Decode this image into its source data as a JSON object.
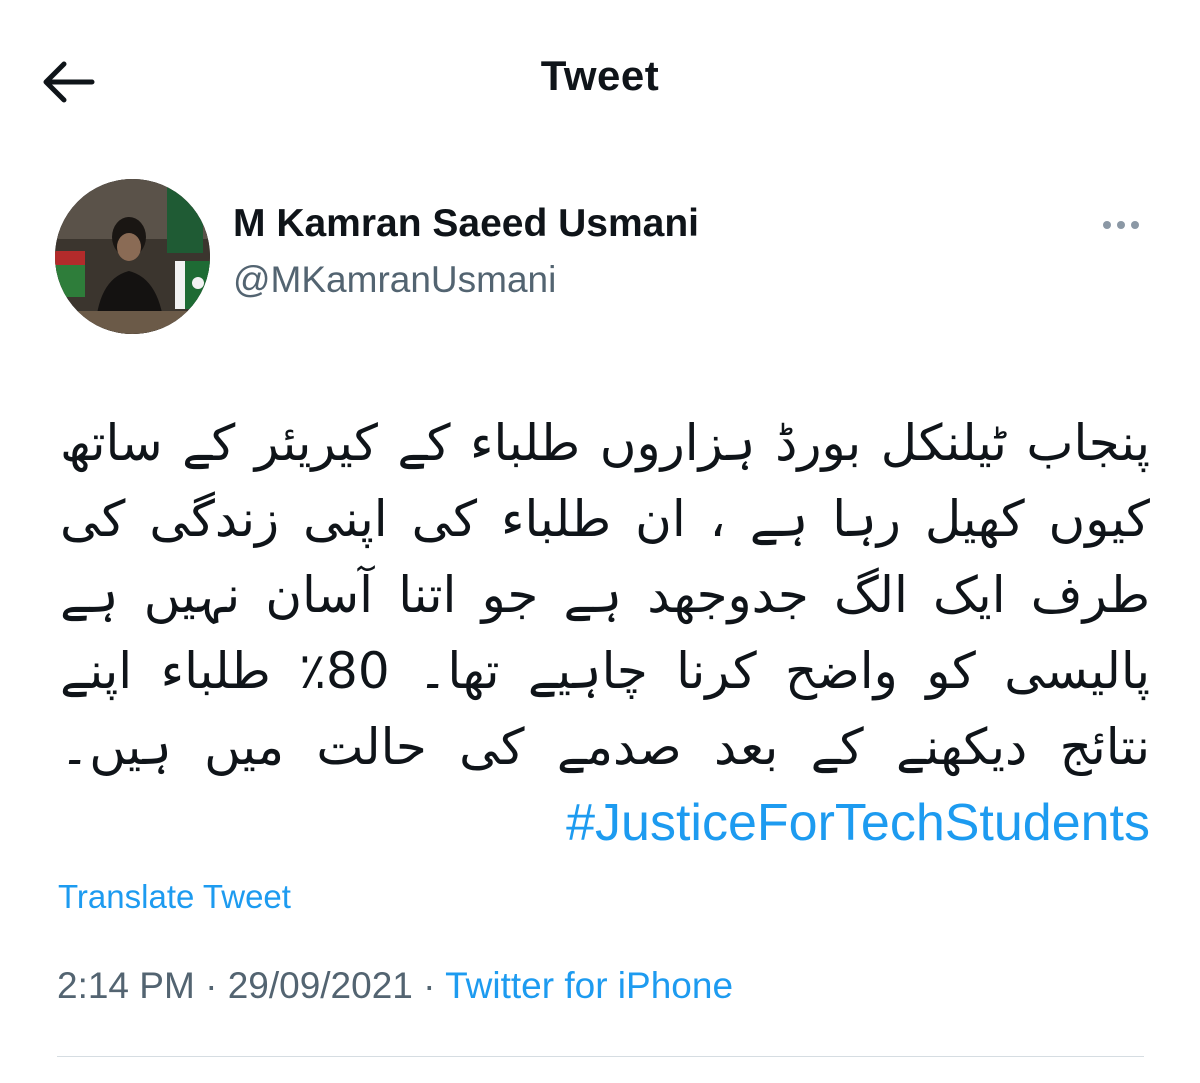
{
  "header": {
    "title": "Tweet",
    "back_icon": "arrow-left-icon"
  },
  "author": {
    "name": "M Kamran Saeed Usmani",
    "handle": "@MKamranUsmani"
  },
  "tweet": {
    "text": "پنجاب ٹیلنکل بورڈ ہزاروں طلباء کے کیریئر کے ساتھ کیوں کھیل رہا ہے ، ان طلباء کی اپنی زندگی کی طرف ایک الگ جدوجھد ہے جو اتنا آسان نہیں ہے پالیسی کو واضح کرنا چاہیے تھا۔ 80٪ طلباء اپنے نتائج دیکھنے کے بعد صدمے کی حالت میں ہیں۔",
    "hashtag": "#JusticeForTechStudents"
  },
  "translate_label": "Translate Tweet",
  "meta": {
    "time": "2:14 PM",
    "date": "29/09/2021",
    "separator": "·",
    "source": "Twitter for iPhone"
  },
  "colors": {
    "link_blue": "#1d9bf0",
    "secondary_gray": "#536471",
    "text_primary": "#0f1419"
  }
}
